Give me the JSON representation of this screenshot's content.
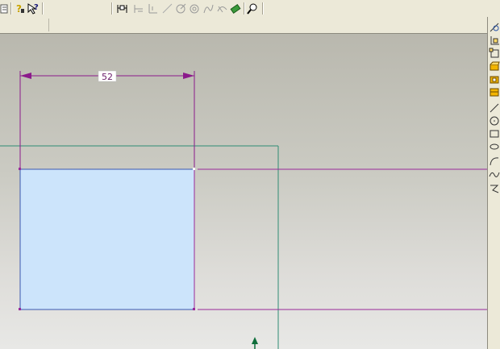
{
  "toolbar": {
    "icons": [
      "partial-left-icon",
      "whats-this-icon",
      "context-help-icon",
      "dimension-icon",
      "smart-dimension-icon",
      "horizontal-dimension-icon",
      "angle-icon",
      "circle-dimension-icon",
      "concentric-icon",
      "tangent-icon",
      "relations-icon",
      "add-relation-icon",
      "zoom-icon"
    ]
  },
  "sketch": {
    "dimension_value": "52"
  },
  "colors": {
    "rectangle_fill": "#cce4fb",
    "rectangle_edge": "#3a57b0",
    "construction_line": "#9a2a9a",
    "dimension_color": "#8b1a8b",
    "frame_line": "#2f8c74",
    "origin_arrow": "#0e6e3a"
  },
  "right_toolbar": {
    "icons": [
      "sketch-icon",
      "plane-icon",
      "view-icon",
      "extrude-boss-icon",
      "extrude-cut-icon",
      "revolve-icon",
      "line-icon",
      "circle-icon",
      "rectangle-icon",
      "ellipse-icon",
      "arc-icon",
      "spline-icon",
      "point-icon"
    ]
  }
}
